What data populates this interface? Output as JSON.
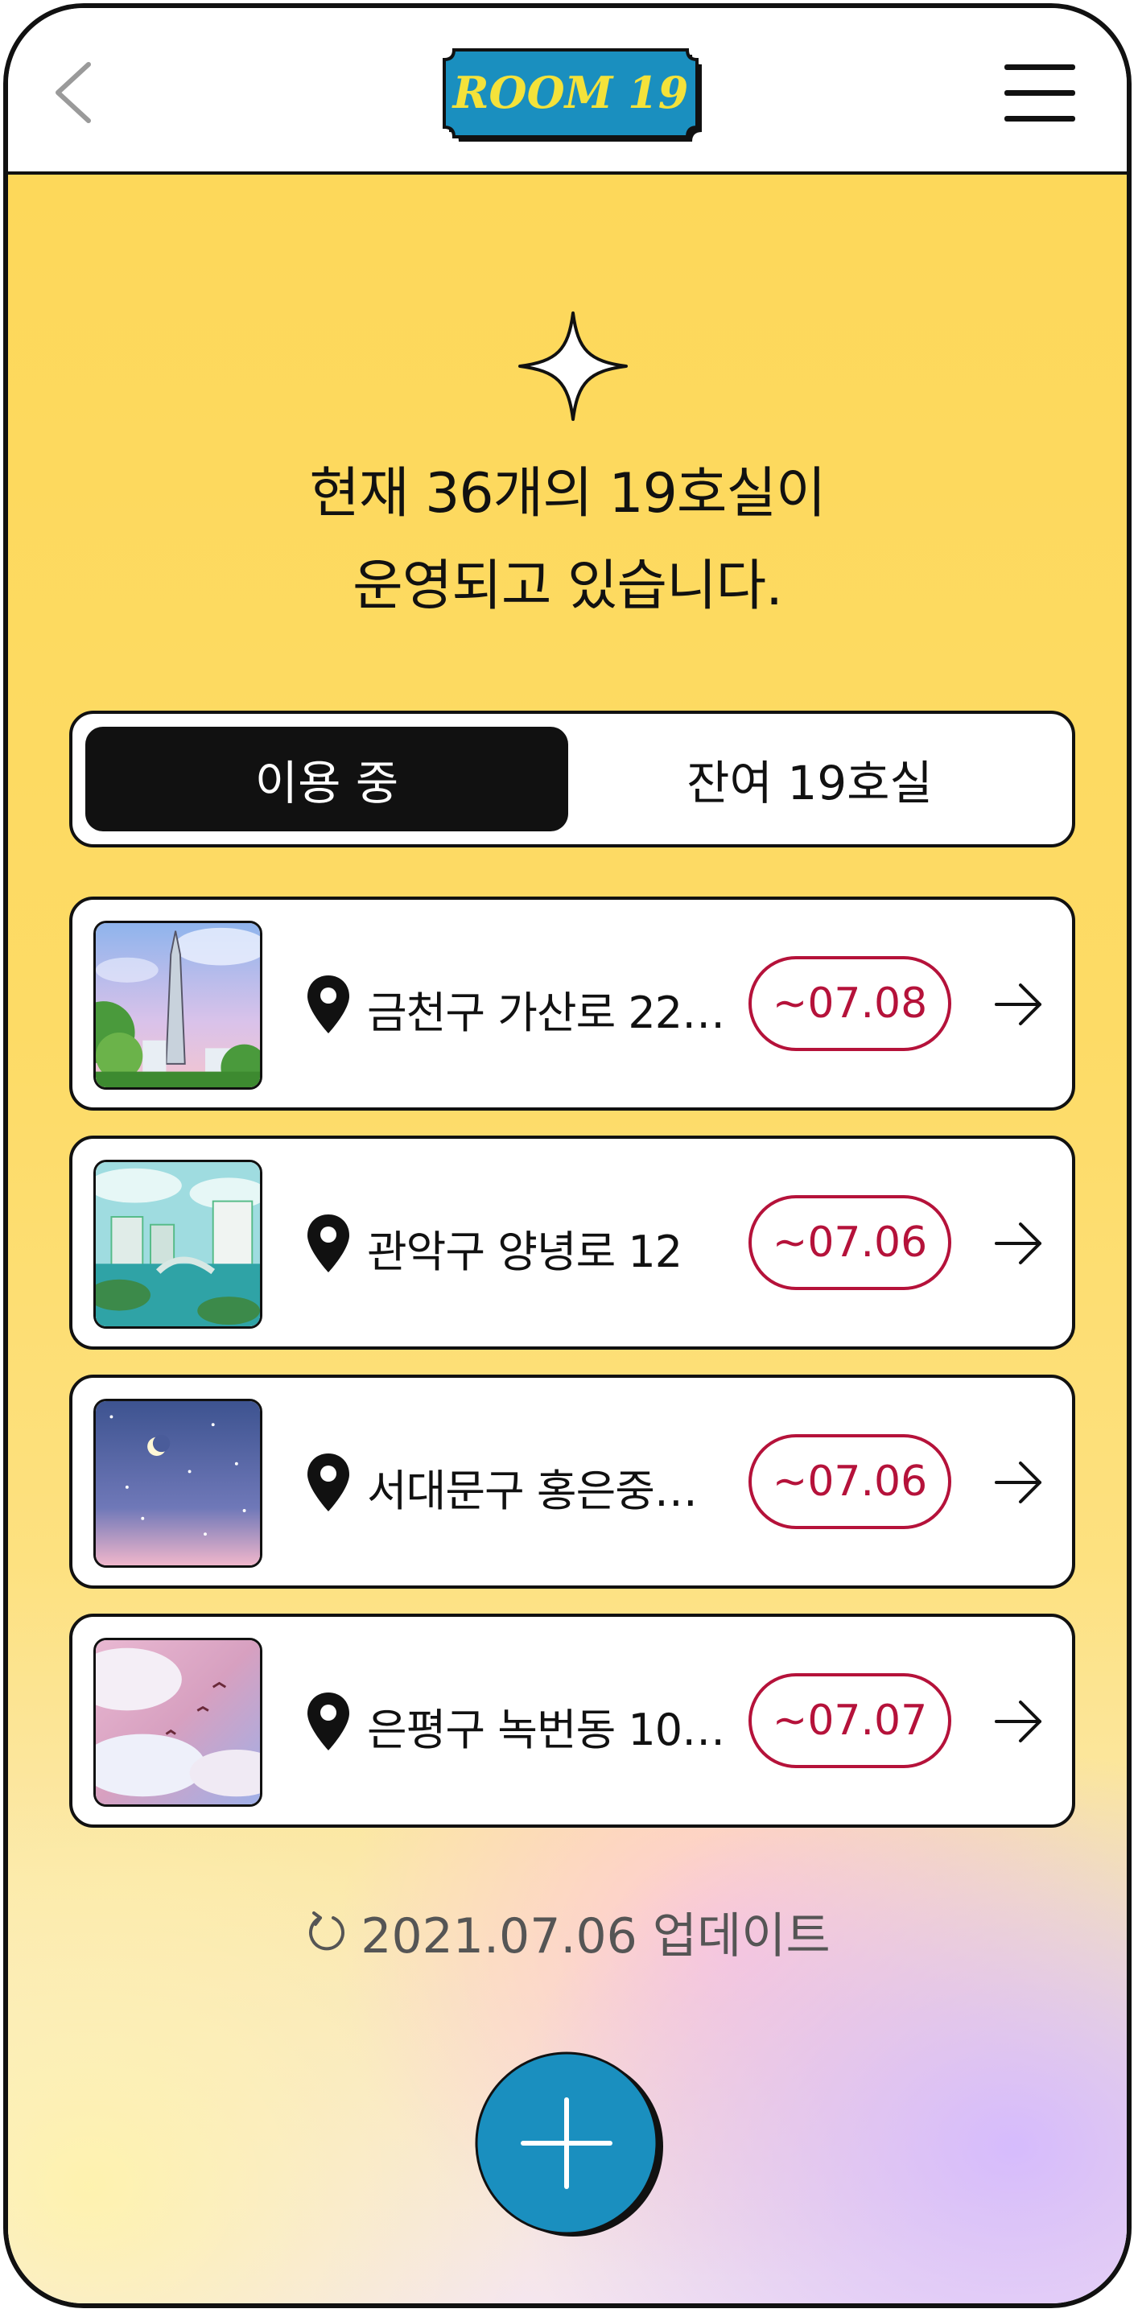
{
  "header": {
    "logo_text": "ROOM 19",
    "colors": {
      "logo_bg": "#1a8fbf",
      "logo_text": "#f4e23a"
    }
  },
  "icons": [
    "chevron-left-icon",
    "hamburger-menu-icon",
    "sparkle-icon",
    "location-pin-icon",
    "arrow-right-icon",
    "refresh-icon",
    "plus-icon"
  ],
  "headline": {
    "line1": "현재 36개의 19호실이",
    "line2": "운영되고 있습니다."
  },
  "tabs": {
    "active": "이용 중",
    "inactive": "잔여 19호실"
  },
  "rooms": [
    {
      "address": "금천구 가산로 22…",
      "date": "~07.08",
      "thumb": "tower-cityscape"
    },
    {
      "address": "관악구 양녕로 12",
      "date": "~07.06",
      "thumb": "city-river"
    },
    {
      "address": "서대문구 홍은중…",
      "date": "~07.06",
      "thumb": "night-sky"
    },
    {
      "address": "은평구 녹번동 10…",
      "date": "~07.07",
      "thumb": "pink-clouds-birds"
    }
  ],
  "update_text": "2021.07.06 업데이트",
  "colors": {
    "accent_red": "#b5123a",
    "fab": "#1a8fbf",
    "background_yellow": "#fdd85a"
  }
}
